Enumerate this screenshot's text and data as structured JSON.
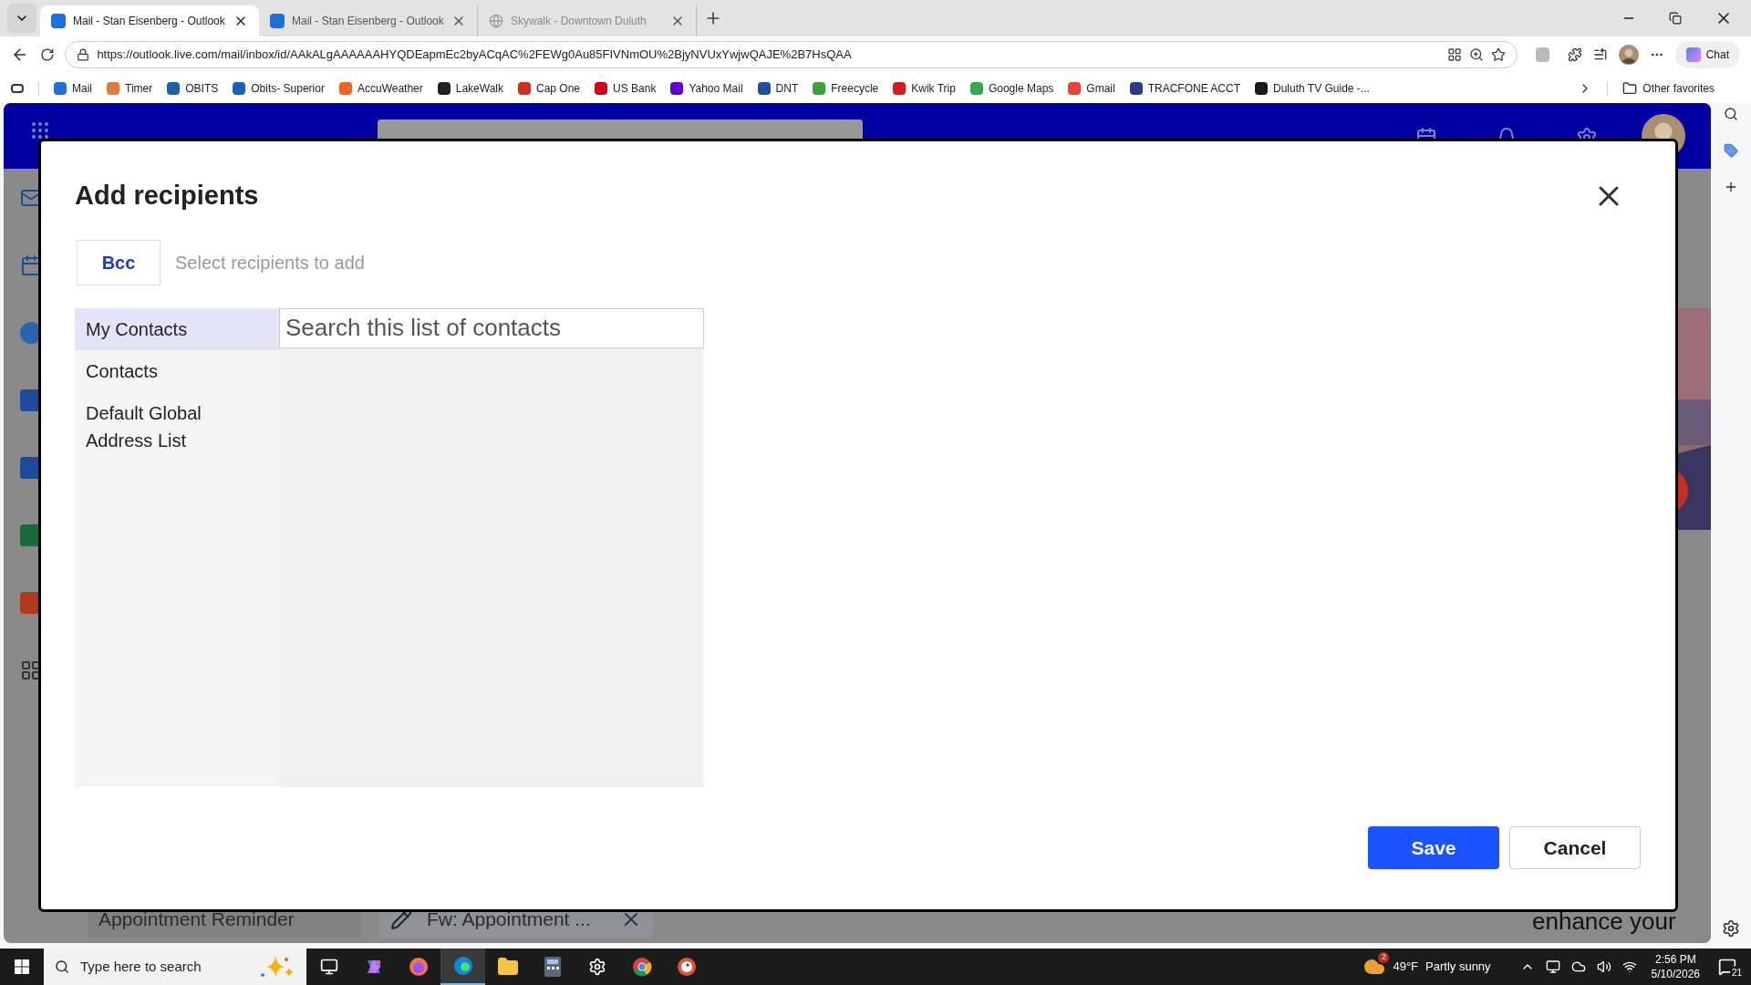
{
  "browser": {
    "tabs": [
      {
        "title": "Mail - Stan Eisenberg - Outlook",
        "selected": true,
        "kind": "outlook"
      },
      {
        "title": "Mail - Stan Eisenberg - Outlook",
        "selected": false,
        "kind": "outlook"
      },
      {
        "title": "Skywalk - Downtown Duluth",
        "selected": false,
        "kind": "globe"
      }
    ],
    "url": "https://outlook.live.com/mail/inbox/id/AAkALgAAAAAAHYQDEapmEc2byACqAC%2FEWg0Au85FIVNmOU%2BjyNVUxYwjwQAJE%2B7HsQAA",
    "chat_label": "Chat",
    "bookmarks": [
      {
        "label": "Mail",
        "color": "#1e6fd9"
      },
      {
        "label": "Timer",
        "color": "#e07a3a"
      },
      {
        "label": "OBITS",
        "color": "#1d5fa8"
      },
      {
        "label": "Obits- Superior",
        "color": "#1565c0"
      },
      {
        "label": "AccuWeather",
        "color": "#f26322"
      },
      {
        "label": "LakeWalk",
        "color": "#222222"
      },
      {
        "label": "Cap One",
        "color": "#d22e1e"
      },
      {
        "label": "US Bank",
        "color": "#d0021b"
      },
      {
        "label": "Yahoo Mail",
        "color": "#6001d2"
      },
      {
        "label": "DNT",
        "color": "#1d4f9a"
      },
      {
        "label": "Freecycle",
        "color": "#3aa03a"
      },
      {
        "label": "Kwik Trip",
        "color": "#d71920"
      },
      {
        "label": "Google Maps",
        "color": "#34a853"
      },
      {
        "label": "Gmail",
        "color": "#ea4335"
      },
      {
        "label": "TRACFONE ACCT",
        "color": "#2a3b8f"
      },
      {
        "label": "Duluth TV Guide -...",
        "color": "#1b1b1b"
      }
    ],
    "other_favorites": "Other favorites"
  },
  "outlook": {
    "open_items": [
      {
        "title": "Appointment Reminder",
        "kind": "message"
      },
      {
        "title": "Fw: Appointment ...",
        "kind": "draft"
      }
    ],
    "ad_text": "enhance your"
  },
  "dialog": {
    "title": "Add recipients",
    "field_label": "Bcc",
    "recipients_placeholder": "Select recipients to add",
    "lists": [
      {
        "label": "My Contacts",
        "selected": true
      },
      {
        "label": "Contacts",
        "selected": false
      },
      {
        "label": "Default Global Address List",
        "selected": false
      }
    ],
    "search_placeholder": "Search this list of contacts",
    "buttons": [
      {
        "label": "Save",
        "kind": "primary"
      },
      {
        "label": "Cancel",
        "kind": "secondary"
      }
    ]
  },
  "taskbar": {
    "search_placeholder": "Type here to search",
    "apps": [
      {
        "kind": "taskview",
        "selected": false
      },
      {
        "kind": "copilot",
        "selected": false
      },
      {
        "kind": "firefox",
        "selected": false
      },
      {
        "kind": "edge",
        "selected": true
      },
      {
        "kind": "folder",
        "selected": false
      },
      {
        "kind": "calculator",
        "selected": false
      },
      {
        "kind": "settings",
        "selected": false
      },
      {
        "kind": "chrome",
        "selected": false
      },
      {
        "kind": "duck",
        "selected": false
      }
    ],
    "weather_badge": "2",
    "temperature": "49°F",
    "weather": "Partly sunny",
    "time": "2:56 PM",
    "date": "5/10/2026",
    "notifications": "21"
  }
}
